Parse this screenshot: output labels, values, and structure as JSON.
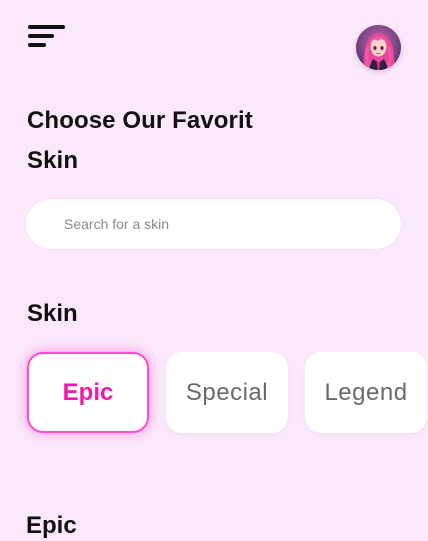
{
  "header": {
    "menu_icon": "hamburger-menu-icon",
    "avatar_icon": "user-avatar"
  },
  "main": {
    "title": "Choose Our Favorit Skin",
    "search": {
      "placeholder": "Search for a skin",
      "value": ""
    },
    "skin_section": {
      "title": "Skin",
      "categories": [
        {
          "label": "Epic",
          "selected": true
        },
        {
          "label": "Special",
          "selected": false
        },
        {
          "label": "Legend",
          "selected": false
        }
      ]
    },
    "list_section": {
      "title": "Epic"
    }
  },
  "colors": {
    "background": "#fbe9fb",
    "accent": "#f01aa8",
    "accent_glow": "#ff4fcc",
    "card": "#ffffff",
    "text_dark": "#111111",
    "text_muted": "#6a6a6a"
  }
}
